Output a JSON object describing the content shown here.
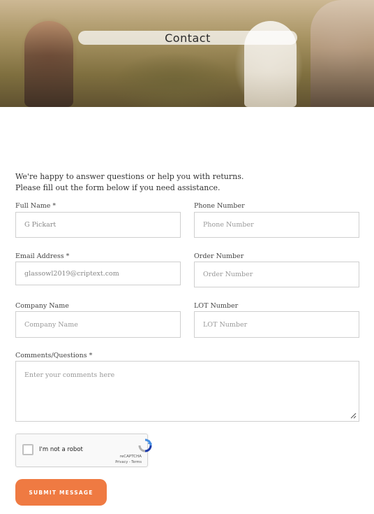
{
  "header": {
    "title": "Contact"
  },
  "intro": {
    "line1": "We're happy to answer questions or help you with returns.",
    "line2": "Please fill out the form below if you need assistance."
  },
  "form": {
    "full_name": {
      "label": "Full Name *",
      "value": "G Pickart"
    },
    "phone": {
      "label": "Phone Number",
      "placeholder": "Phone Number"
    },
    "email": {
      "label": "Email Address *",
      "value": "glassowl2019@criptext.com"
    },
    "order": {
      "label": "Order Number",
      "placeholder": "Order Number"
    },
    "company": {
      "label": "Company Name",
      "placeholder": "Company Name"
    },
    "lot": {
      "label": "LOT Number",
      "placeholder": "LOT Number"
    },
    "comments": {
      "label": "Comments/Questions *",
      "placeholder": "Enter your comments here"
    }
  },
  "recaptcha": {
    "label": "I'm not a robot",
    "brand": "reCAPTCHA",
    "links": "Privacy - Terms"
  },
  "submit": {
    "label": "SUBMIT MESSAGE"
  },
  "colors": {
    "accent": "#ef7a42",
    "border": "#cfcfcf"
  }
}
